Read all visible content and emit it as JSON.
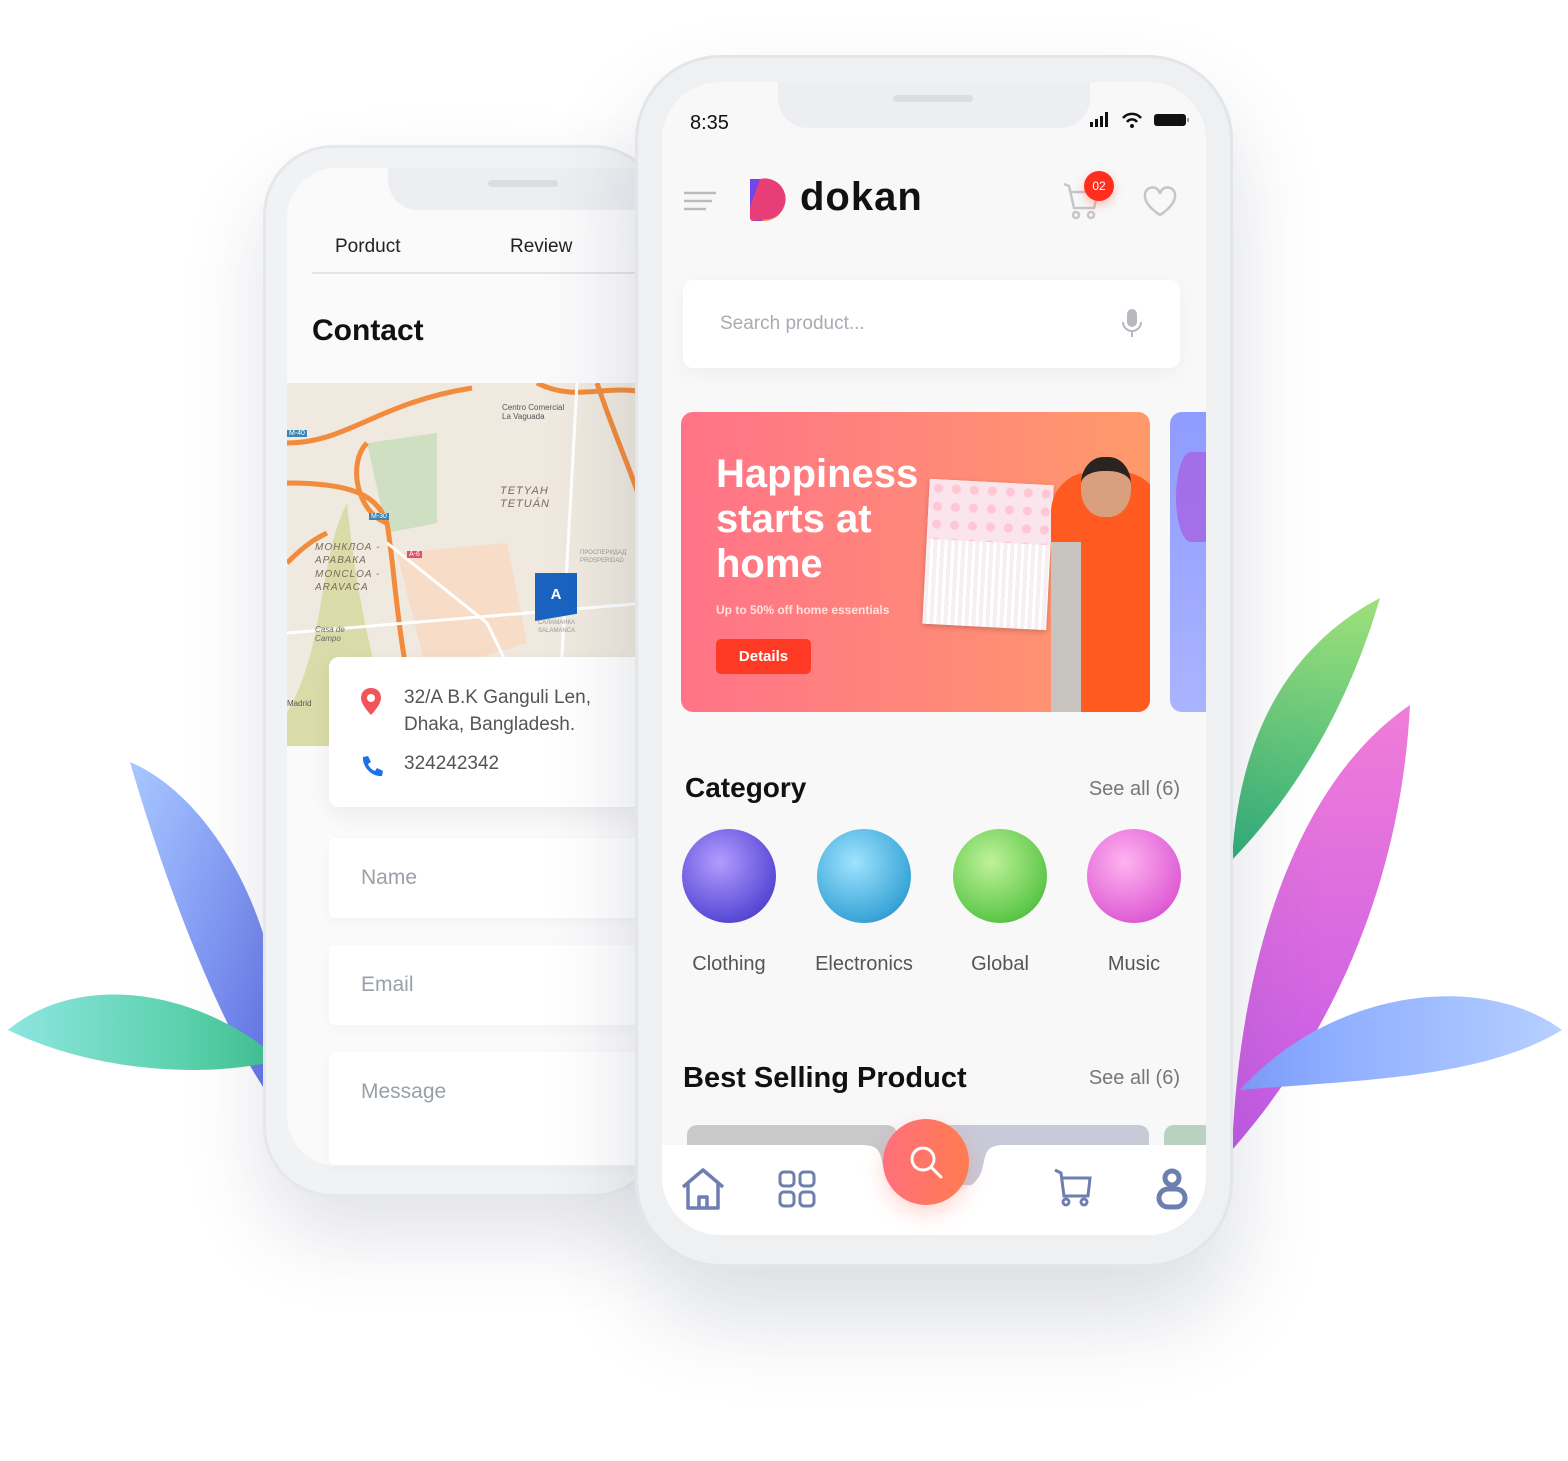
{
  "back_phone": {
    "tabs": [
      {
        "label": "Porduct"
      },
      {
        "label": "Review"
      }
    ],
    "title": "Contact",
    "map": {
      "labels": [
        "Centro Comercial",
        "La Vaguada",
        "TETYAH",
        "TETUÁN",
        "МОНКЛОА - АРАВАКА",
        "MONCLOA - ARAVACA",
        "Casa de Campo",
        "M-40",
        "M-30",
        "A-6",
        "ПРОСПЕРИДАД",
        "PROSPERIDAD",
        "САЛАМАНКА",
        "SALAMANCA",
        "Madrid"
      ],
      "marker": "A"
    },
    "address_line1": "32/A B.K Ganguli Len,",
    "address_line2": "Dhaka, Bangladesh.",
    "phone": "324242342",
    "form": {
      "name_placeholder": "Name",
      "email_placeholder": "Email",
      "message_placeholder": "Message"
    }
  },
  "front_phone": {
    "status": {
      "time": "8:35"
    },
    "brand": "dokan",
    "cart_badge": "02",
    "search": {
      "placeholder": "Search product..."
    },
    "banner": {
      "title_line1": "Happiness",
      "title_line2": "starts at",
      "title_line3": "home",
      "subtitle": "Up to 50% off home essentials",
      "button": "Details"
    },
    "category": {
      "title": "Category",
      "see_all": "See all (6)",
      "items": [
        {
          "label": "Clothing"
        },
        {
          "label": "Electronics"
        },
        {
          "label": "Global"
        },
        {
          "label": "Music"
        }
      ]
    },
    "best_selling": {
      "title": "Best Selling Product",
      "see_all": "See all (6)"
    },
    "bottom_nav": [
      "home-icon",
      "grid-icon",
      "search-icon",
      "cart-icon",
      "user-icon"
    ]
  },
  "colors": {
    "accent": "#ff3a24",
    "banner_start": "#ff7388",
    "banner_end": "#ff9a6b",
    "nav_icon": "#6d7fae",
    "badge": "#ff2f1f"
  }
}
